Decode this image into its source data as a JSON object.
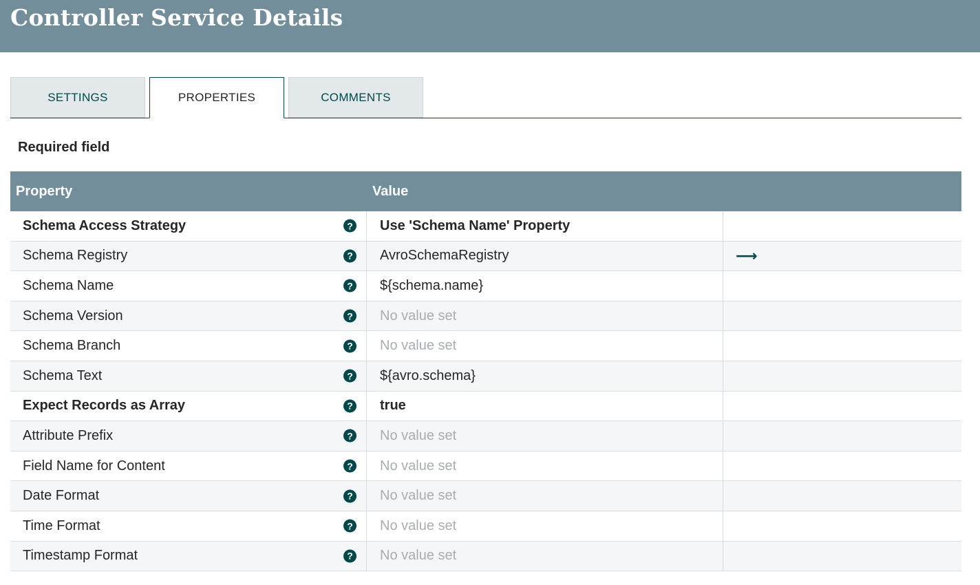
{
  "header": {
    "title": "Controller Service Details"
  },
  "tabs": [
    {
      "label": "SETTINGS",
      "active": false
    },
    {
      "label": "PROPERTIES",
      "active": true
    },
    {
      "label": "COMMENTS",
      "active": false
    }
  ],
  "required_label": "Required field",
  "grid": {
    "columns": {
      "property": "Property",
      "value": "Value"
    },
    "rows": [
      {
        "property": "Schema Access Strategy",
        "value": "Use 'Schema Name' Property",
        "required": true,
        "unset": false,
        "goto": false
      },
      {
        "property": "Schema Registry",
        "value": "AvroSchemaRegistry",
        "required": false,
        "unset": false,
        "goto": true
      },
      {
        "property": "Schema Name",
        "value": "${schema.name}",
        "required": false,
        "unset": false,
        "goto": false
      },
      {
        "property": "Schema Version",
        "value": "No value set",
        "required": false,
        "unset": true,
        "goto": false
      },
      {
        "property": "Schema Branch",
        "value": "No value set",
        "required": false,
        "unset": true,
        "goto": false
      },
      {
        "property": "Schema Text",
        "value": "${avro.schema}",
        "required": false,
        "unset": false,
        "goto": false
      },
      {
        "property": "Expect Records as Array",
        "value": "true",
        "required": true,
        "unset": false,
        "goto": false
      },
      {
        "property": "Attribute Prefix",
        "value": "No value set",
        "required": false,
        "unset": true,
        "goto": false
      },
      {
        "property": "Field Name for Content",
        "value": "No value set",
        "required": false,
        "unset": true,
        "goto": false
      },
      {
        "property": "Date Format",
        "value": "No value set",
        "required": false,
        "unset": true,
        "goto": false
      },
      {
        "property": "Time Format",
        "value": "No value set",
        "required": false,
        "unset": true,
        "goto": false
      },
      {
        "property": "Timestamp Format",
        "value": "No value set",
        "required": false,
        "unset": true,
        "goto": false
      }
    ]
  },
  "icons": {
    "help": "help-circle-icon",
    "goto": "arrow-right-icon",
    "help_glyph": "?",
    "goto_glyph": "⟶"
  },
  "colors": {
    "header": "#728e9b",
    "accent": "#004849",
    "unset_text": "#a8adb0"
  }
}
